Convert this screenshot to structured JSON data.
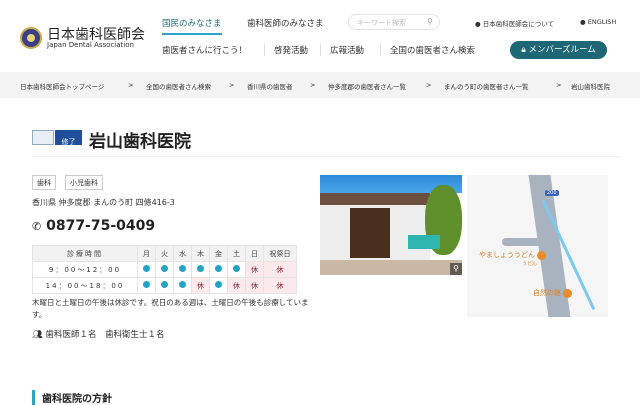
{
  "header": {
    "logo_jp": "日本歯科医師会",
    "logo_en": "Japan Dental Association",
    "nav_primary": [
      "国民のみなさま",
      "歯科医師のみなさま"
    ],
    "search_placeholder": "キーワード検索",
    "top_links": [
      "日本歯科医師会について",
      "ENGLISH"
    ],
    "nav_secondary": [
      "歯医者さんに行こう！",
      "啓発活動",
      "広報活動",
      "全国の歯医者さん検索"
    ],
    "member_button": "メンバーズルーム"
  },
  "breadcrumb": [
    "日本歯科医師会トップページ",
    "全国の歯医者さん検索",
    "香川県の歯医者",
    "仲多度郡の歯医者さん一覧",
    "まんのう町の歯医者さん一覧",
    "岩山歯科医院"
  ],
  "clinic": {
    "badge": "修了",
    "name": "岩山歯科医院",
    "tags": [
      "歯科",
      "小児歯科"
    ],
    "address": "香川県 仲多度郡 まんのう町 四條416-3",
    "phone": "0877-75-0409",
    "schedule": {
      "header": [
        "診療時間",
        "月",
        "火",
        "水",
        "木",
        "金",
        "土",
        "日",
        "祝祭日"
      ],
      "rows": [
        {
          "time": "9：00～12：00",
          "days": [
            "open",
            "open",
            "open",
            "open",
            "open",
            "open",
            "休",
            "休"
          ]
        },
        {
          "time": "14：00～18：00",
          "days": [
            "open",
            "open",
            "open",
            "休",
            "open",
            "休",
            "休",
            "休"
          ]
        }
      ]
    },
    "note": "木曜日と土曜日の午後は休診です。祝日のある週は、土曜日の午後も診療しています。",
    "staff": "歯科医師１名　歯科衛生士１名"
  },
  "map": {
    "route": "200",
    "pois": [
      "やましょううどん",
      "うどん",
      "自然の館"
    ]
  },
  "section_heading": "歯科医院の方針",
  "colors": {
    "accent": "#2aa6c4",
    "member_button": "#1d6777",
    "closed_bg": "#fbe9ec"
  }
}
